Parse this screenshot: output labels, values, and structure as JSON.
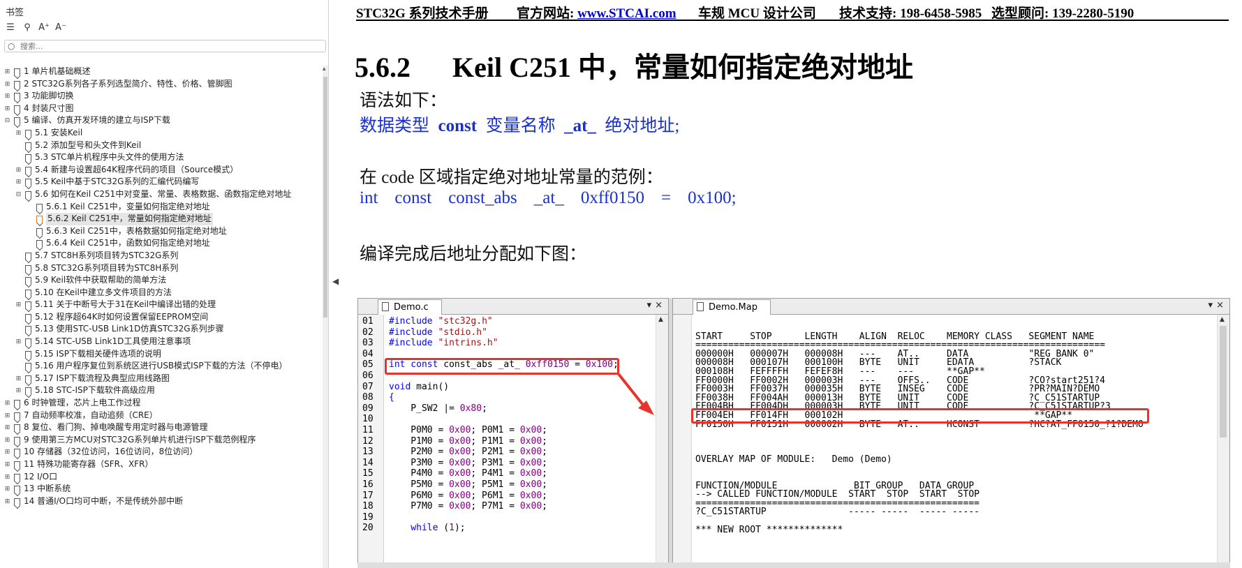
{
  "sidebar": {
    "title": "书签",
    "search_placeholder": "搜索...",
    "items": [
      {
        "label": "1 单片机基础概述",
        "level": 0,
        "expander": "plus"
      },
      {
        "label": "2 STC32G系列各子系列选型简介、特性、价格、管脚图",
        "level": 0,
        "expander": "plus"
      },
      {
        "label": "3 功能脚切换",
        "level": 0,
        "expander": "plus"
      },
      {
        "label": "4 封装尺寸图",
        "level": 0,
        "expander": "plus"
      },
      {
        "label": "5 编译、仿真开发环境的建立与ISP下载",
        "level": 0,
        "expander": "minus"
      },
      {
        "label": "5.1 安装Keil",
        "level": 1,
        "expander": "plus"
      },
      {
        "label": "5.2 添加型号和头文件到Keil",
        "level": 1,
        "expander": "none"
      },
      {
        "label": "5.3 STC单片机程序中头文件的使用方法",
        "level": 1,
        "expander": "none"
      },
      {
        "label": "5.4 新建与设置超64K程序代码的项目（Source模式）",
        "level": 1,
        "expander": "plus"
      },
      {
        "label": "5.5 Keil中基于STC32G系列的汇编代码编写",
        "level": 1,
        "expander": "plus"
      },
      {
        "label": "5.6 如何在Keil C251中对变量、常量、表格数据、函数指定绝对地址",
        "level": 1,
        "expander": "minus"
      },
      {
        "label": "5.6.1 Keil C251中，变量如何指定绝对地址",
        "level": 2,
        "expander": "none"
      },
      {
        "label": "5.6.2 Keil C251中，常量如何指定绝对地址",
        "level": 2,
        "expander": "none",
        "selected": true
      },
      {
        "label": "5.6.3 Keil C251中，表格数据如何指定绝对地址",
        "level": 2,
        "expander": "none"
      },
      {
        "label": "5.6.4 Keil C251中，函数如何指定绝对地址",
        "level": 2,
        "expander": "none"
      },
      {
        "label": "5.7 STC8H系列项目转为STC32G系列",
        "level": 1,
        "expander": "none"
      },
      {
        "label": "5.8 STC32G系列项目转为STC8H系列",
        "level": 1,
        "expander": "none"
      },
      {
        "label": "5.9 Keil软件中获取帮助的简单方法",
        "level": 1,
        "expander": "none"
      },
      {
        "label": "5.10 在Keil中建立多文件项目的方法",
        "level": 1,
        "expander": "none"
      },
      {
        "label": "5.11 关于中断号大于31在Keil中编译出错的处理",
        "level": 1,
        "expander": "plus"
      },
      {
        "label": "5.12 程序超64K时如何设置保留EEPROM空间",
        "level": 1,
        "expander": "none"
      },
      {
        "label": "5.13 使用STC-USB Link1D仿真STC32G系列步骤",
        "level": 1,
        "expander": "none"
      },
      {
        "label": "5.14 STC-USB Link1D工具使用注意事项",
        "level": 1,
        "expander": "plus"
      },
      {
        "label": "5.15 ISP下载相关硬件选项的说明",
        "level": 1,
        "expander": "none"
      },
      {
        "label": "5.16 用户程序复位到系统区进行USB模式ISP下载的方法（不停电）",
        "level": 1,
        "expander": "none"
      },
      {
        "label": "5.17 ISP下载流程及典型应用线路图",
        "level": 1,
        "expander": "plus"
      },
      {
        "label": "5.18 STC-ISP下载软件高级应用",
        "level": 1,
        "expander": "plus"
      },
      {
        "label": "6 时钟管理，芯片上电工作过程",
        "level": 0,
        "expander": "plus"
      },
      {
        "label": "7 自动频率校准，自动追频（CRE）",
        "level": 0,
        "expander": "plus"
      },
      {
        "label": "8 复位、看门狗、掉电唤醒专用定时器与电源管理",
        "level": 0,
        "expander": "plus"
      },
      {
        "label": "9 使用第三方MCU对STC32G系列单片机进行ISP下载范例程序",
        "level": 0,
        "expander": "plus"
      },
      {
        "label": "10 存储器（32位访问，16位访问，8位访问）",
        "level": 0,
        "expander": "plus"
      },
      {
        "label": "11 特殊功能寄存器（SFR、XFR）",
        "level": 0,
        "expander": "plus"
      },
      {
        "label": "12 I/O口",
        "level": 0,
        "expander": "plus"
      },
      {
        "label": "13 中断系统",
        "level": 0,
        "expander": "plus"
      },
      {
        "label": "14 普通I/O口均可中断，不是传统外部中断",
        "level": 0,
        "expander": "plus"
      }
    ]
  },
  "header": {
    "manual": "STC32G 系列技术手册",
    "site_label": "官方网站: ",
    "site_link": "www.STCAI.com",
    "company": "车规 MCU 设计公司",
    "support": "技术支持: 198-6458-5985",
    "consultant": "选型顾问: 139-2280-5190"
  },
  "section": {
    "number": "5.6.2",
    "title": "Keil C251 中，常量如何指定绝对地址"
  },
  "body": {
    "syntax_intro": "语法如下：",
    "syntax": {
      "part1": "数据类型",
      "kw_const": "const",
      "part2": "变量名称",
      "kw_at": "_at_",
      "part3": "绝对地址;"
    },
    "example_intro": "在 code 区域指定绝对地址常量的范例：",
    "example": [
      "int",
      "const",
      "const_abs",
      "_at_",
      "0xff0150",
      "=",
      "0x100;"
    ],
    "result_intro": "编译完成后地址分配如下图："
  },
  "ide": {
    "left_tab": "Demo.c",
    "right_tab": "Demo.Map",
    "close_glyph": "×",
    "menu_glyph": "▾",
    "code_lines": [
      {
        "n": "01",
        "segs": [
          [
            "kw",
            "#include "
          ],
          [
            "st",
            "\"stc32g.h\""
          ]
        ]
      },
      {
        "n": "02",
        "segs": [
          [
            "kw",
            "#include "
          ],
          [
            "st",
            "\"stdio.h\""
          ]
        ]
      },
      {
        "n": "03",
        "segs": [
          [
            "kw",
            "#include "
          ],
          [
            "st",
            "\"intrins.h\""
          ]
        ]
      },
      {
        "n": "04",
        "segs": []
      },
      {
        "n": "05",
        "segs": [
          [
            "kw",
            "int const "
          ],
          [
            "pl",
            "const_abs _at_ "
          ],
          [
            "nm",
            "0xff0150"
          ],
          [
            "pl",
            " = "
          ],
          [
            "nm",
            "0x100"
          ],
          [
            "pl",
            ";"
          ]
        ]
      },
      {
        "n": "06",
        "segs": []
      },
      {
        "n": "07",
        "segs": [
          [
            "kw",
            "void "
          ],
          [
            "pl",
            "main()"
          ]
        ]
      },
      {
        "n": "08",
        "segs": [
          [
            "kw",
            "{"
          ]
        ]
      },
      {
        "n": "09",
        "segs": [
          [
            "pl",
            "    P_SW2 |= "
          ],
          [
            "nm",
            "0x80"
          ],
          [
            "pl",
            ";"
          ]
        ]
      },
      {
        "n": "10",
        "segs": []
      },
      {
        "n": "11",
        "segs": [
          [
            "pl",
            "    P0M0 = "
          ],
          [
            "nm",
            "0x00"
          ],
          [
            "pl",
            "; P0M1 = "
          ],
          [
            "nm",
            "0x00"
          ],
          [
            "pl",
            ";"
          ]
        ]
      },
      {
        "n": "12",
        "segs": [
          [
            "pl",
            "    P1M0 = "
          ],
          [
            "nm",
            "0x00"
          ],
          [
            "pl",
            "; P1M1 = "
          ],
          [
            "nm",
            "0x00"
          ],
          [
            "pl",
            ";"
          ]
        ]
      },
      {
        "n": "13",
        "segs": [
          [
            "pl",
            "    P2M0 = "
          ],
          [
            "nm",
            "0x00"
          ],
          [
            "pl",
            "; P2M1 = "
          ],
          [
            "nm",
            "0x00"
          ],
          [
            "pl",
            ";"
          ]
        ]
      },
      {
        "n": "14",
        "segs": [
          [
            "pl",
            "    P3M0 = "
          ],
          [
            "nm",
            "0x00"
          ],
          [
            "pl",
            "; P3M1 = "
          ],
          [
            "nm",
            "0x00"
          ],
          [
            "pl",
            ";"
          ]
        ]
      },
      {
        "n": "15",
        "segs": [
          [
            "pl",
            "    P4M0 = "
          ],
          [
            "nm",
            "0x00"
          ],
          [
            "pl",
            "; P4M1 = "
          ],
          [
            "nm",
            "0x00"
          ],
          [
            "pl",
            ";"
          ]
        ]
      },
      {
        "n": "16",
        "segs": [
          [
            "pl",
            "    P5M0 = "
          ],
          [
            "nm",
            "0x00"
          ],
          [
            "pl",
            "; P5M1 = "
          ],
          [
            "nm",
            "0x00"
          ],
          [
            "pl",
            ";"
          ]
        ]
      },
      {
        "n": "17",
        "segs": [
          [
            "pl",
            "    P6M0 = "
          ],
          [
            "nm",
            "0x00"
          ],
          [
            "pl",
            "; P6M1 = "
          ],
          [
            "nm",
            "0x00"
          ],
          [
            "pl",
            ";"
          ]
        ]
      },
      {
        "n": "18",
        "segs": [
          [
            "pl",
            "    P7M0 = "
          ],
          [
            "nm",
            "0x00"
          ],
          [
            "pl",
            "; P7M1 = "
          ],
          [
            "nm",
            "0x00"
          ],
          [
            "pl",
            ";"
          ]
        ]
      },
      {
        "n": "19",
        "segs": []
      },
      {
        "n": "20",
        "segs": [
          [
            "kw",
            "    while "
          ],
          [
            "pl",
            "("
          ],
          [
            "nm",
            "1"
          ],
          [
            "pl",
            ");"
          ]
        ]
      }
    ],
    "map_lines": [
      "",
      "START     STOP      LENGTH    ALIGN  RELOC    MEMORY CLASS   SEGMENT NAME",
      "===========================================================================",
      "000000H   000007H   000008H   ---    AT..     DATA           \"REG BANK 0\"",
      "000008H   000107H   000100H   BYTE   UNIT     EDATA          ?STACK",
      "000108H   FEFFFFH   FEFEF8H   ---    ---      **GAP**",
      "FF0000H   FF0002H   000003H   ---    OFFS..   CODE           ?CO?start251?4",
      "FF0003H   FF0037H   000035H   BYTE   INSEG    CODE           ?PR?MAIN?DEMO",
      "FF0038H   FF004AH   000013H   BYTE   UNIT     CODE           ?C_C51STARTUP",
      "FF004BH   FF004DH   000003H   BYTE   UNIT     CODE           ?C_C51STARTUP?3",
      "FF004EH   FF014FH   000102H                                   **GAP**",
      "FF0150H   FF0151H   000002H   BYTE   AT..     HCONST         ?HC?AT_FF0150_?1?DEMO",
      "",
      "",
      "",
      "OVERLAY MAP OF MODULE:   Demo (Demo)",
      "",
      "",
      "FUNCTION/MODULE              BIT_GROUP   DATA_GROUP",
      "--> CALLED FUNCTION/MODULE  START  STOP  START  STOP",
      "====================================================",
      "?C_C51STARTUP               ----- -----  ----- -----",
      "",
      "*** NEW ROOT **************"
    ]
  },
  "colors": {
    "accent_red": "#e8322b",
    "blue_text": "#1a31c8"
  }
}
